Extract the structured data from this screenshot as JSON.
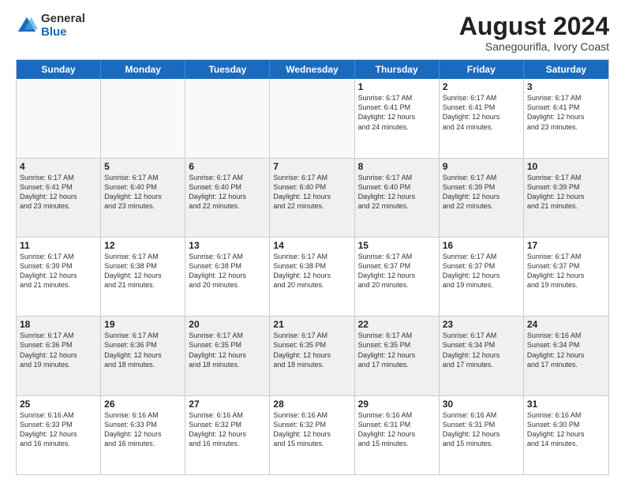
{
  "logo": {
    "general": "General",
    "blue": "Blue"
  },
  "header": {
    "title": "August 2024",
    "subtitle": "Sanegourifla, Ivory Coast"
  },
  "days_of_week": [
    "Sunday",
    "Monday",
    "Tuesday",
    "Wednesday",
    "Thursday",
    "Friday",
    "Saturday"
  ],
  "weeks": [
    [
      {
        "day": "",
        "info": "",
        "empty": true
      },
      {
        "day": "",
        "info": "",
        "empty": true
      },
      {
        "day": "",
        "info": "",
        "empty": true
      },
      {
        "day": "",
        "info": "",
        "empty": true
      },
      {
        "day": "1",
        "info": "Sunrise: 6:17 AM\nSunset: 6:41 PM\nDaylight: 12 hours\nand 24 minutes."
      },
      {
        "day": "2",
        "info": "Sunrise: 6:17 AM\nSunset: 6:41 PM\nDaylight: 12 hours\nand 24 minutes."
      },
      {
        "day": "3",
        "info": "Sunrise: 6:17 AM\nSunset: 6:41 PM\nDaylight: 12 hours\nand 23 minutes."
      }
    ],
    [
      {
        "day": "4",
        "info": "Sunrise: 6:17 AM\nSunset: 6:41 PM\nDaylight: 12 hours\nand 23 minutes.",
        "shaded": true
      },
      {
        "day": "5",
        "info": "Sunrise: 6:17 AM\nSunset: 6:40 PM\nDaylight: 12 hours\nand 23 minutes.",
        "shaded": true
      },
      {
        "day": "6",
        "info": "Sunrise: 6:17 AM\nSunset: 6:40 PM\nDaylight: 12 hours\nand 22 minutes.",
        "shaded": true
      },
      {
        "day": "7",
        "info": "Sunrise: 6:17 AM\nSunset: 6:40 PM\nDaylight: 12 hours\nand 22 minutes.",
        "shaded": true
      },
      {
        "day": "8",
        "info": "Sunrise: 6:17 AM\nSunset: 6:40 PM\nDaylight: 12 hours\nand 22 minutes.",
        "shaded": true
      },
      {
        "day": "9",
        "info": "Sunrise: 6:17 AM\nSunset: 6:39 PM\nDaylight: 12 hours\nand 22 minutes.",
        "shaded": true
      },
      {
        "day": "10",
        "info": "Sunrise: 6:17 AM\nSunset: 6:39 PM\nDaylight: 12 hours\nand 21 minutes.",
        "shaded": true
      }
    ],
    [
      {
        "day": "11",
        "info": "Sunrise: 6:17 AM\nSunset: 6:39 PM\nDaylight: 12 hours\nand 21 minutes."
      },
      {
        "day": "12",
        "info": "Sunrise: 6:17 AM\nSunset: 6:38 PM\nDaylight: 12 hours\nand 21 minutes."
      },
      {
        "day": "13",
        "info": "Sunrise: 6:17 AM\nSunset: 6:38 PM\nDaylight: 12 hours\nand 20 minutes."
      },
      {
        "day": "14",
        "info": "Sunrise: 6:17 AM\nSunset: 6:38 PM\nDaylight: 12 hours\nand 20 minutes."
      },
      {
        "day": "15",
        "info": "Sunrise: 6:17 AM\nSunset: 6:37 PM\nDaylight: 12 hours\nand 20 minutes."
      },
      {
        "day": "16",
        "info": "Sunrise: 6:17 AM\nSunset: 6:37 PM\nDaylight: 12 hours\nand 19 minutes."
      },
      {
        "day": "17",
        "info": "Sunrise: 6:17 AM\nSunset: 6:37 PM\nDaylight: 12 hours\nand 19 minutes."
      }
    ],
    [
      {
        "day": "18",
        "info": "Sunrise: 6:17 AM\nSunset: 6:36 PM\nDaylight: 12 hours\nand 19 minutes.",
        "shaded": true
      },
      {
        "day": "19",
        "info": "Sunrise: 6:17 AM\nSunset: 6:36 PM\nDaylight: 12 hours\nand 18 minutes.",
        "shaded": true
      },
      {
        "day": "20",
        "info": "Sunrise: 6:17 AM\nSunset: 6:35 PM\nDaylight: 12 hours\nand 18 minutes.",
        "shaded": true
      },
      {
        "day": "21",
        "info": "Sunrise: 6:17 AM\nSunset: 6:35 PM\nDaylight: 12 hours\nand 18 minutes.",
        "shaded": true
      },
      {
        "day": "22",
        "info": "Sunrise: 6:17 AM\nSunset: 6:35 PM\nDaylight: 12 hours\nand 17 minutes.",
        "shaded": true
      },
      {
        "day": "23",
        "info": "Sunrise: 6:17 AM\nSunset: 6:34 PM\nDaylight: 12 hours\nand 17 minutes.",
        "shaded": true
      },
      {
        "day": "24",
        "info": "Sunrise: 6:16 AM\nSunset: 6:34 PM\nDaylight: 12 hours\nand 17 minutes.",
        "shaded": true
      }
    ],
    [
      {
        "day": "25",
        "info": "Sunrise: 6:16 AM\nSunset: 6:33 PM\nDaylight: 12 hours\nand 16 minutes."
      },
      {
        "day": "26",
        "info": "Sunrise: 6:16 AM\nSunset: 6:33 PM\nDaylight: 12 hours\nand 16 minutes."
      },
      {
        "day": "27",
        "info": "Sunrise: 6:16 AM\nSunset: 6:32 PM\nDaylight: 12 hours\nand 16 minutes."
      },
      {
        "day": "28",
        "info": "Sunrise: 6:16 AM\nSunset: 6:32 PM\nDaylight: 12 hours\nand 15 minutes."
      },
      {
        "day": "29",
        "info": "Sunrise: 6:16 AM\nSunset: 6:31 PM\nDaylight: 12 hours\nand 15 minutes."
      },
      {
        "day": "30",
        "info": "Sunrise: 6:16 AM\nSunset: 6:31 PM\nDaylight: 12 hours\nand 15 minutes."
      },
      {
        "day": "31",
        "info": "Sunrise: 6:16 AM\nSunset: 6:30 PM\nDaylight: 12 hours\nand 14 minutes."
      }
    ]
  ]
}
